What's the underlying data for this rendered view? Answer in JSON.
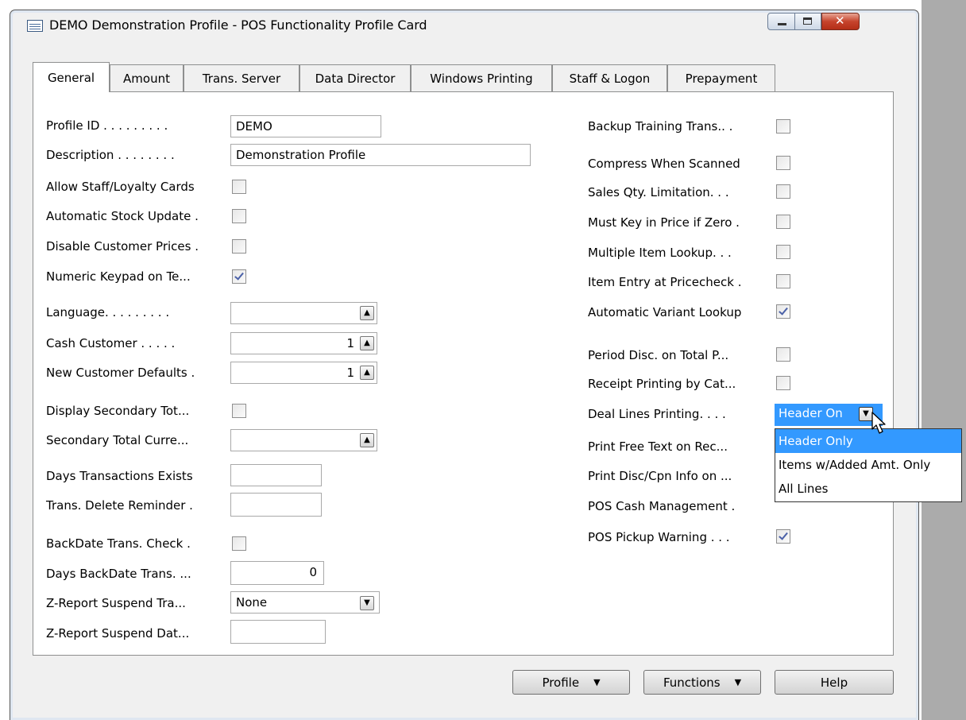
{
  "window": {
    "title": "DEMO Demonstration Profile - POS Functionality Profile Card"
  },
  "tabs": [
    "General",
    "Amount",
    "Trans. Server",
    "Data Director",
    "Windows Printing",
    "Staff & Logon",
    "Prepayment"
  ],
  "left": {
    "profile_id": {
      "label": "Profile ID . . . . . . . . .",
      "value": "DEMO"
    },
    "description": {
      "label": "Description . . . . . . . .",
      "value": "Demonstration Profile"
    },
    "allow_staff": {
      "label": "Allow Staff/Loyalty Cards",
      "checked": false
    },
    "auto_stock": {
      "label": "Automatic Stock Update .",
      "checked": false
    },
    "disable_prices": {
      "label": "Disable Customer Prices .",
      "checked": false
    },
    "numeric_keypad": {
      "label": "Numeric Keypad on Te...",
      "checked": true
    },
    "language": {
      "label": "Language. . . . . . . . .",
      "value": ""
    },
    "cash_customer": {
      "label": "Cash Customer . . . . .",
      "value": "1"
    },
    "new_cust_defaults": {
      "label": "New Customer Defaults .",
      "value": "1"
    },
    "display_secondary": {
      "label": "Display Secondary Tot...",
      "checked": false
    },
    "secondary_currency": {
      "label": "Secondary Total Curre...",
      "value": ""
    },
    "days_trans_exists": {
      "label": "Days Transactions Exists",
      "value": ""
    },
    "trans_delete": {
      "label": "Trans. Delete Reminder .",
      "value": ""
    },
    "backdate_check": {
      "label": "BackDate Trans. Check .",
      "checked": false
    },
    "days_backdate": {
      "label": "Days BackDate Trans. ...",
      "value": "0"
    },
    "zreport_tra": {
      "label": "Z-Report Suspend Tra...",
      "value": "None"
    },
    "zreport_dat": {
      "label": "Z-Report Suspend Dat...",
      "value": ""
    }
  },
  "right": {
    "backup_training": {
      "label": "Backup Training Trans.. .",
      "checked": false
    },
    "compress": {
      "label": "Compress When Scanned",
      "checked": false
    },
    "sales_qty": {
      "label": "Sales Qty. Limitation. . .",
      "checked": false
    },
    "must_key": {
      "label": "Must Key in Price if Zero .",
      "checked": false
    },
    "multiple_item": {
      "label": "Multiple Item Lookup. . .",
      "checked": false
    },
    "item_entry": {
      "label": "Item Entry at Pricecheck .",
      "checked": false
    },
    "auto_variant": {
      "label": "Automatic Variant Lookup",
      "checked": true
    },
    "period_disc": {
      "label": "Period Disc. on Total P...",
      "checked": false
    },
    "receipt_printing": {
      "label": "Receipt Printing by Cat...",
      "checked": false
    },
    "deal_lines": {
      "label": "Deal Lines Printing. . . .",
      "value": "Header On"
    },
    "print_free_text": {
      "label": "Print Free Text on Rec..."
    },
    "print_disc": {
      "label": "Print Disc/Cpn Info on ..."
    },
    "pos_cash": {
      "label": "POS Cash Management ."
    },
    "pos_pickup": {
      "label": "POS Pickup Warning . . .",
      "checked": true
    }
  },
  "dropdown": {
    "options": [
      "Header Only",
      "Items w/Added Amt. Only",
      "All Lines"
    ],
    "selected": "Header Only"
  },
  "buttons": {
    "profile": "Profile",
    "functions": "Functions",
    "help": "Help"
  }
}
